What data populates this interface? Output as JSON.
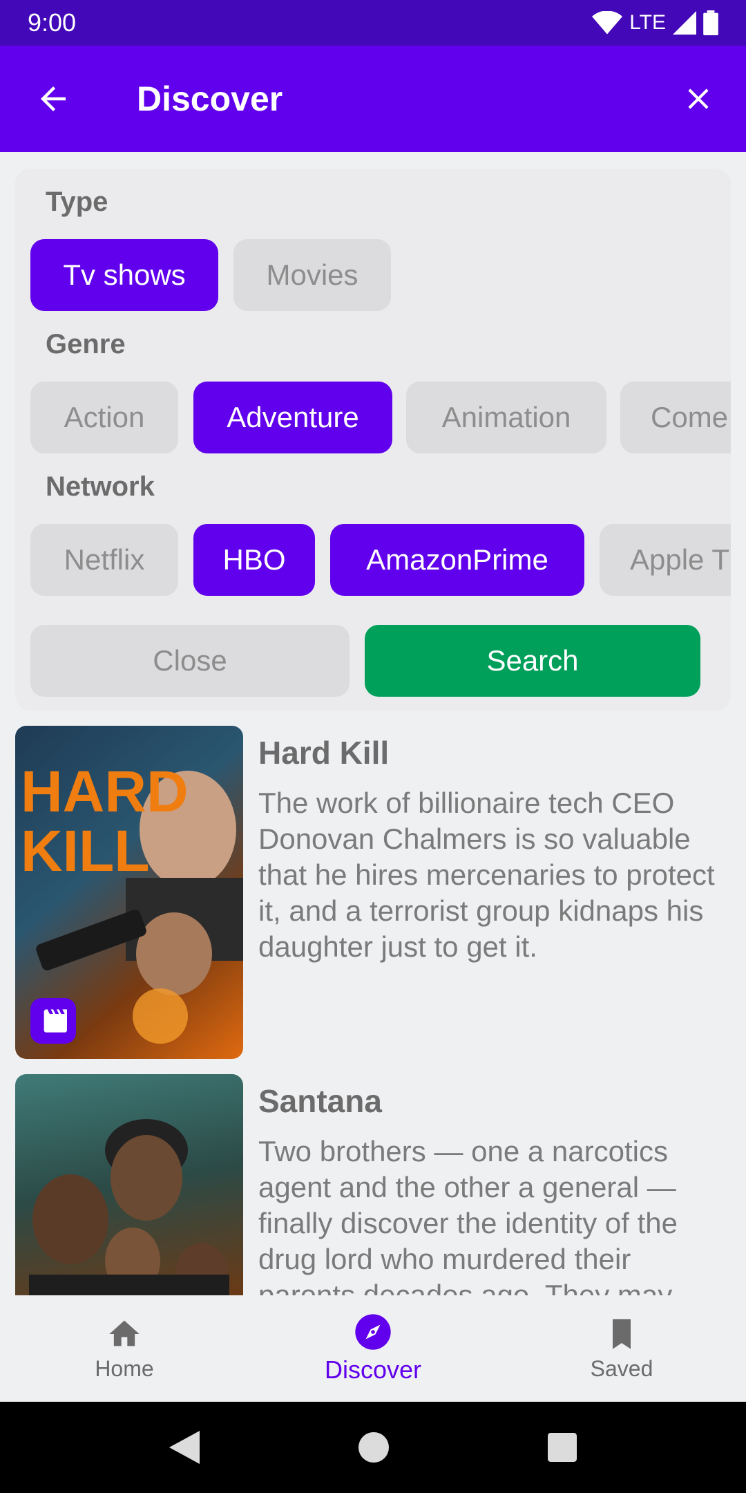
{
  "status_bar": {
    "time": "9:00",
    "network": "LTE"
  },
  "app_bar": {
    "title": "Discover"
  },
  "filters": {
    "type_label": "Type",
    "type_options": [
      {
        "label": "Tv shows",
        "selected": true
      },
      {
        "label": "Movies",
        "selected": false
      }
    ],
    "genre_label": "Genre",
    "genre_options": [
      {
        "label": "Action",
        "selected": false
      },
      {
        "label": "Adventure",
        "selected": true
      },
      {
        "label": "Animation",
        "selected": false
      },
      {
        "label": "Come",
        "selected": false
      }
    ],
    "network_label": "Network",
    "network_options": [
      {
        "label": "Netflix",
        "selected": false
      },
      {
        "label": "HBO",
        "selected": true
      },
      {
        "label": "AmazonPrime",
        "selected": true
      },
      {
        "label": "Apple T",
        "selected": false
      }
    ],
    "close_label": "Close",
    "search_label": "Search"
  },
  "results": [
    {
      "title": "Hard Kill",
      "poster_text": "HARD KILL",
      "description": "The work of billionaire tech CEO Donovan Chalmers is so valuable that he hires mercenaries to protect it, and a terrorist group kidnaps his daughter just to get it.",
      "badge_icon": "movie-clapper-icon"
    },
    {
      "title": "Santana",
      "description": "Two brothers — one a narcotics agent and the other a general — finally discover the identity of the drug lord who murdered their parents decades ago. They may"
    }
  ],
  "bottom_nav": [
    {
      "label": "Home",
      "icon": "home-icon",
      "active": false
    },
    {
      "label": "Discover",
      "icon": "compass-icon",
      "active": true
    },
    {
      "label": "Saved",
      "icon": "bookmark-icon",
      "active": false
    }
  ],
  "colors": {
    "primary": "#6100ec",
    "status_bar": "#4308b7",
    "search": "#00a05a",
    "chip_off": "#dcdcde"
  }
}
